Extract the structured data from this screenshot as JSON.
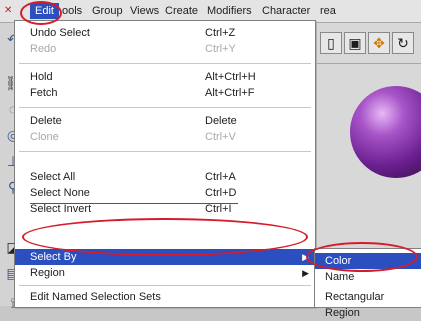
{
  "menubar": {
    "items": [
      {
        "label": "Edit"
      },
      {
        "label": "ools"
      },
      {
        "label": "Group"
      },
      {
        "label": "Views"
      },
      {
        "label": "Create"
      },
      {
        "label": "Modifiers"
      },
      {
        "label": "Character"
      },
      {
        "label": "rea"
      }
    ]
  },
  "edit_menu": {
    "items": [
      {
        "label": "Undo Select",
        "shortcut": "Ctrl+Z"
      },
      {
        "label": "Redo",
        "shortcut": "Ctrl+Y"
      },
      {
        "label": "Hold",
        "shortcut": "Alt+Ctrl+H"
      },
      {
        "label": "Fetch",
        "shortcut": "Alt+Ctrl+F"
      },
      {
        "label": "Delete",
        "shortcut": "Delete"
      },
      {
        "label": "Clone",
        "shortcut": "Ctrl+V"
      },
      {
        "label": "Select All",
        "shortcut": "Ctrl+A"
      },
      {
        "label": "Select None",
        "shortcut": "Ctrl+D"
      },
      {
        "label": "Select Invert",
        "shortcut": "Ctrl+I"
      },
      {
        "label": "Select By",
        "shortcut": ""
      },
      {
        "label": "Region",
        "shortcut": ""
      },
      {
        "label": "Edit Named Selection Sets",
        "shortcut": ""
      }
    ]
  },
  "select_by_submenu": {
    "items": [
      {
        "label": "Color"
      },
      {
        "label": "Name"
      },
      {
        "label": "Rectangular Region"
      }
    ]
  },
  "colors": {
    "highlight": "#2c4fbf",
    "annotation_red": "#d51c2a",
    "sphere": "#8b39b0"
  }
}
